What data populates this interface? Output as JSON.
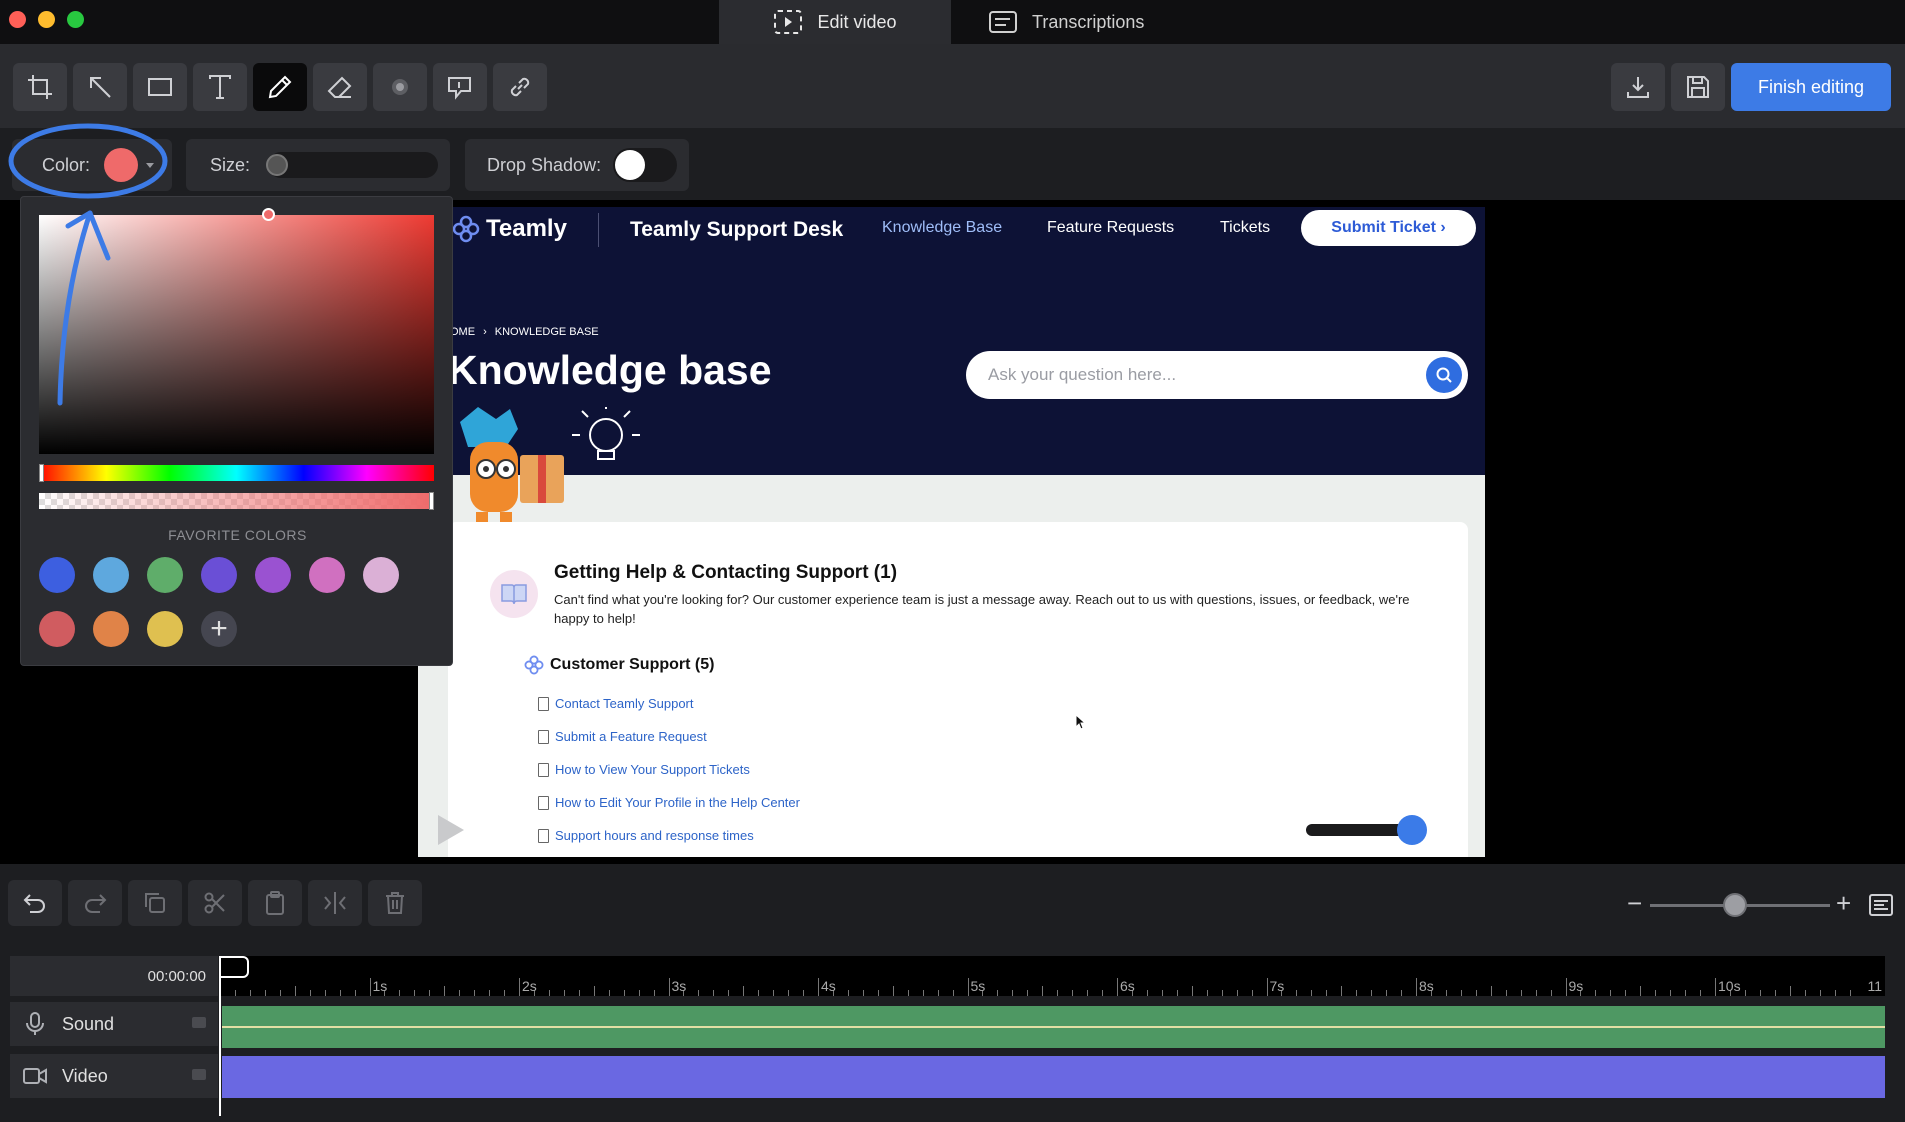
{
  "tabs": {
    "edit": "Edit video",
    "transcriptions": "Transcriptions"
  },
  "toolbar": {
    "tools": [
      "crop-icon",
      "arrow-icon",
      "rectangle-icon",
      "text-icon",
      "pen-icon",
      "eraser-icon",
      "blur-icon",
      "callout-icon",
      "link-icon"
    ],
    "finish_label": "Finish editing"
  },
  "options": {
    "color_label": "Color:",
    "size_label": "Size:",
    "shadow_label": "Drop Shadow:",
    "color_value": "#ef6a6a",
    "drop_shadow_on": false
  },
  "picker": {
    "favorite_label": "FAVORITE COLORS",
    "favorites": [
      "#3d5fe0",
      "#5ea8de",
      "#5fad6a",
      "#6a4fd6",
      "#9a52d1",
      "#d070c0",
      "#dbb0d6",
      "#d05c60",
      "#e08348",
      "#dfc050"
    ],
    "add_label": "+"
  },
  "preview": {
    "logo": "Teamly",
    "desk_title": "Teamly Support Desk",
    "nav": [
      "Knowledge Base",
      "Feature Requests",
      "Tickets"
    ],
    "submit_label": "Submit Ticket ›",
    "breadcrumb_home": "OME",
    "breadcrumb_sep": "›",
    "breadcrumb_current": "KNOWLEDGE BASE",
    "page_title": "Knowledge base",
    "search_placeholder": "Ask your question here...",
    "category_title": "Getting Help & Contacting Support (1)",
    "category_desc": "Can't find what you're looking for? Our customer experience team is just a message away. Reach out to us with questions, issues, or feedback, we're happy to help!",
    "subcategory_title": "Customer Support (5)",
    "articles": [
      "Contact Teamly Support",
      "Submit a Feature Request",
      "How to View Your Support Tickets",
      "How to Edit Your Profile in the Help Center",
      "Support hours and response times"
    ]
  },
  "timeline": {
    "current_time": "00:00:00",
    "ticks": [
      "1s",
      "2s",
      "3s",
      "4s",
      "5s",
      "6s",
      "7s",
      "8s",
      "9s",
      "10s",
      "11"
    ],
    "tracks": [
      "Sound",
      "Video"
    ],
    "zoom_minus": "−",
    "zoom_plus": "+"
  },
  "colors": {
    "accent": "#3d7be6",
    "sound_track": "#4e9863",
    "video_track": "#6a68e2"
  }
}
